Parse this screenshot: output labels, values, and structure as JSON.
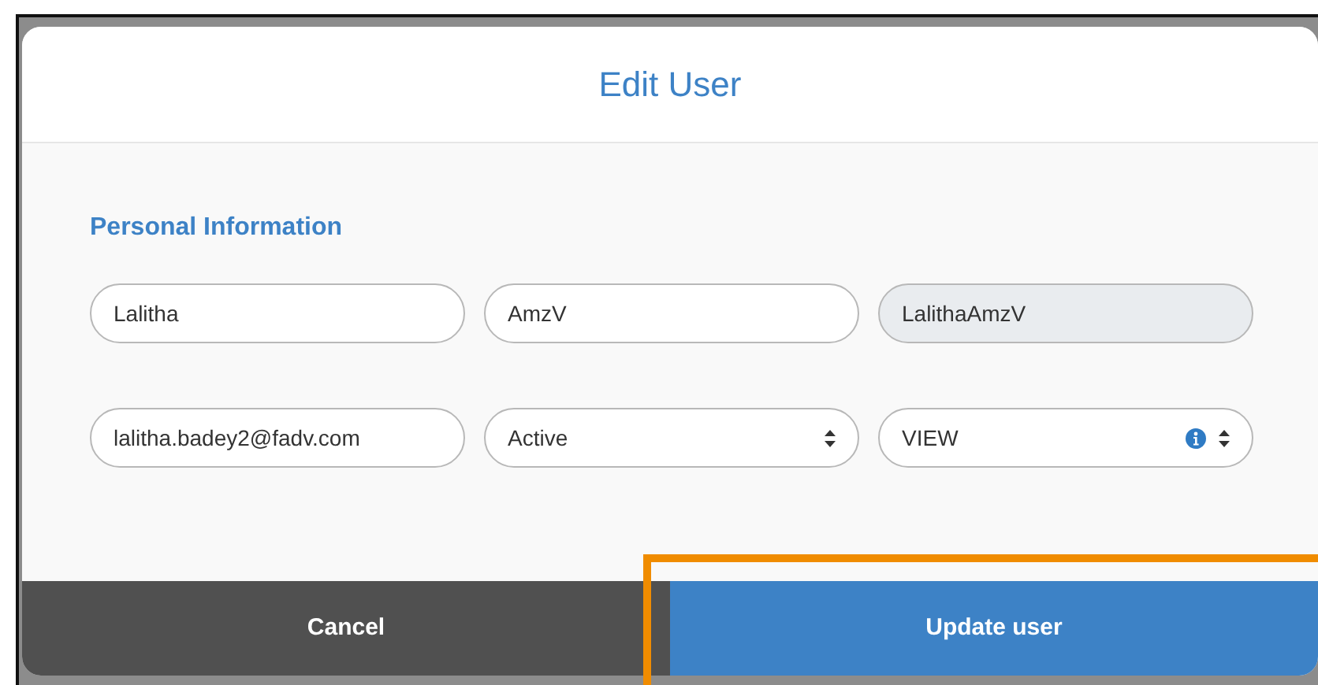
{
  "modal": {
    "title": "Edit User"
  },
  "section": {
    "title": "Personal Information"
  },
  "field_rows": [
    [
      {
        "kind": "text",
        "value": "Lalitha",
        "disabled": false
      },
      {
        "kind": "text",
        "value": "AmzV",
        "disabled": false
      },
      {
        "kind": "text",
        "value": "LalithaAmzV",
        "disabled": true
      }
    ],
    [
      {
        "kind": "text",
        "value": "lalitha.badey2@fadv.com",
        "disabled": false
      },
      {
        "kind": "select",
        "value": "Active",
        "disabled": false
      },
      {
        "kind": "select_info",
        "value": "VIEW",
        "disabled": false
      }
    ]
  ],
  "buttons": [
    {
      "kind": "cancel",
      "label": "Cancel",
      "highlighted": false
    },
    {
      "kind": "primary",
      "label": "Update user",
      "highlighted": true
    }
  ]
}
